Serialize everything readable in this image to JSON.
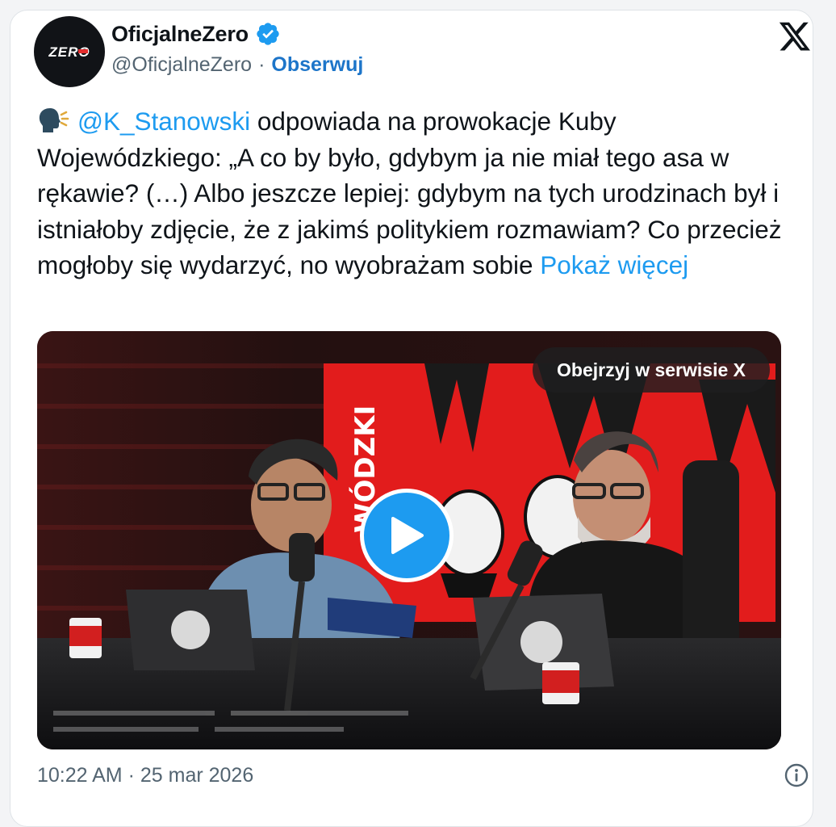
{
  "author": {
    "display_name": "OficjalneZero",
    "handle": "@OficjalneZero",
    "separator": "·",
    "follow_label": "Obserwuj",
    "avatar_text": "ZERO",
    "verified": true,
    "verified_color": "#1d9bf0"
  },
  "tweet": {
    "emoji": "speaking-head-icon",
    "mention": "@K_Stanowski",
    "body": " odpowiada na prowokacje Kuby Wojewódzkiego: „A co by było, gdybym ja nie miał tego asa w rękawie? (…) Albo jeszcze lepiej: gdybym na tych urodzinach był i istniałoby zdjęcie, że z jakimś politykiem rozmawiam? Co przecież mogłoby się wydarzyć, no wyobrażam sobie ",
    "show_more": "Pokaż więcej"
  },
  "media": {
    "watch_label": "Obejrzyj w serwisie X",
    "backdrop_text": "WÓDZKI",
    "play_icon": "play-icon"
  },
  "footer": {
    "time": "10:22 AM",
    "date": "25 mar 2026",
    "separator": "·",
    "info_icon": "info-icon"
  },
  "colors": {
    "link": "#1d9bf0",
    "follow": "#1d75c9",
    "muted": "#536471",
    "text": "#0f1419"
  }
}
